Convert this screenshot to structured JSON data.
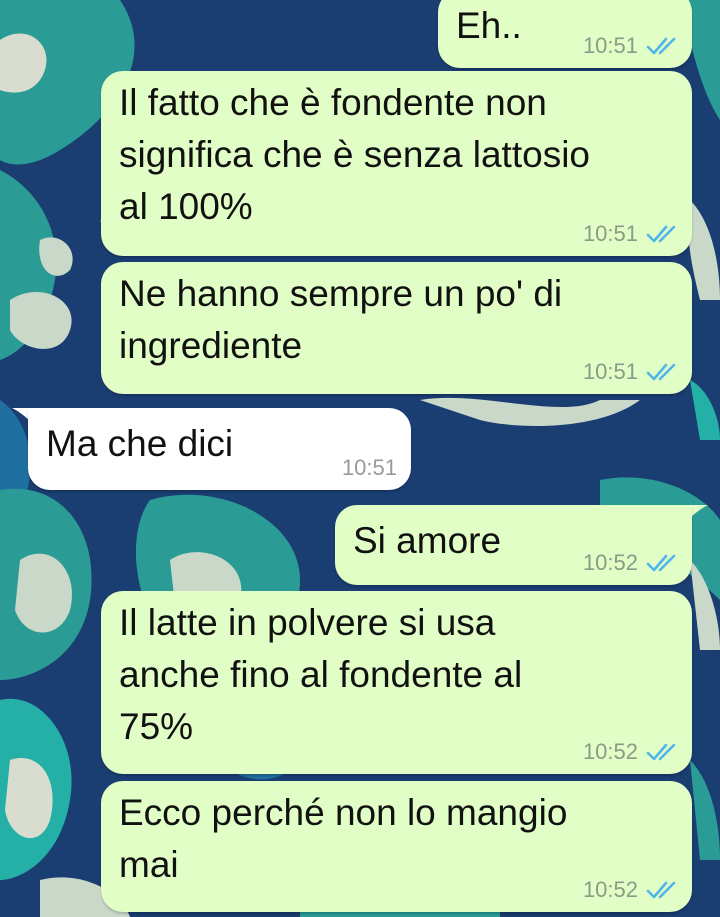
{
  "colors": {
    "outgoing_bubble": "#e1fec6",
    "incoming_bubble": "#ffffff",
    "read_ticks": "#4fb6ec",
    "time_text": "#8c9a86",
    "wallpaper_dark": "#1a3d72",
    "wallpaper_teal": "#2a9c95",
    "wallpaper_cream": "#c9d8c8"
  },
  "icons": {
    "read_receipt": "double-check-icon"
  },
  "messages": [
    {
      "direction": "outgoing",
      "text": "Eh..",
      "time": "10:51",
      "status": "read"
    },
    {
      "direction": "outgoing",
      "text": "Il fatto che è fondente non\nsignifica che è senza lattosio\nal 100%",
      "time": "10:51",
      "status": "read"
    },
    {
      "direction": "outgoing",
      "text": "Ne hanno sempre un po' di\ningrediente",
      "time": "10:51",
      "status": "read"
    },
    {
      "direction": "incoming",
      "text": "Ma che dici",
      "time": "10:51"
    },
    {
      "direction": "outgoing",
      "text": "Si amore",
      "time": "10:52",
      "status": "read"
    },
    {
      "direction": "outgoing",
      "text": "Il latte in polvere si usa\nanche fino al fondente al\n75%",
      "time": "10:52",
      "status": "read"
    },
    {
      "direction": "outgoing",
      "text": "Ecco perché non lo mangio\nmai",
      "time": "10:52",
      "status": "read"
    }
  ]
}
